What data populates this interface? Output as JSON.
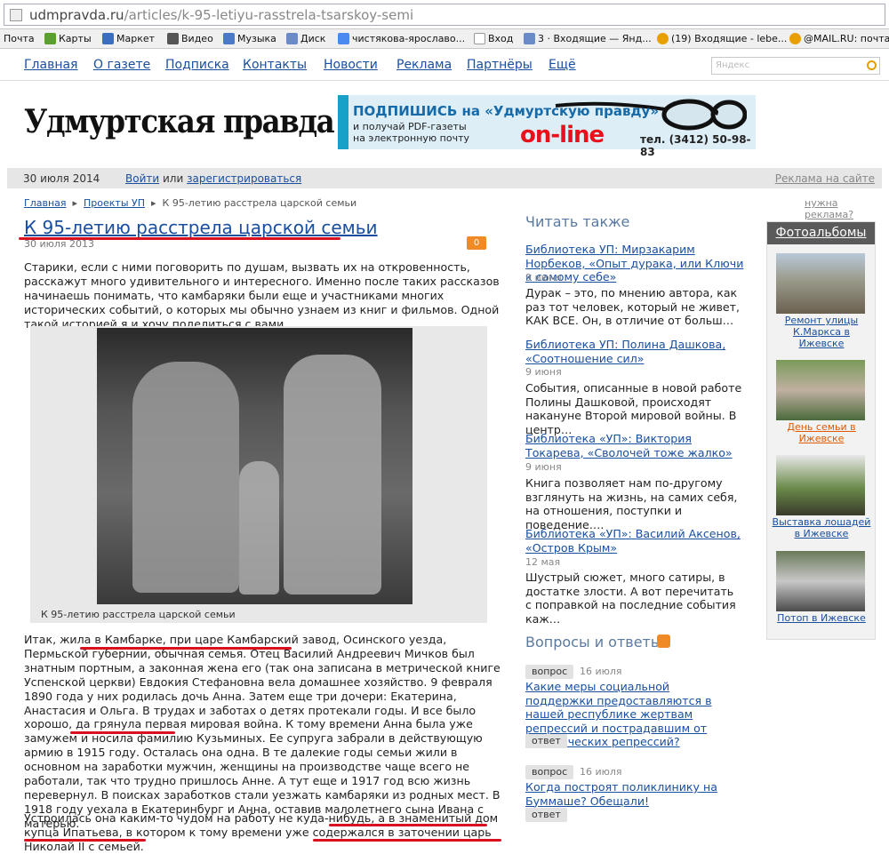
{
  "browser": {
    "url_domain": "udmpravda.ru",
    "url_path": "/articles/k-95-letiyu-rasstrela-tsarskoy-semi",
    "bookmarks": [
      "Почта",
      "Карты",
      "Маркет",
      "Видео",
      "Музыка",
      "Диск",
      "чистякова-ярославо...",
      "Вход",
      "3 · Входящие — Янд...",
      "(19) Входящие - lebe...",
      "@MAIL.RU: почта"
    ]
  },
  "nav": {
    "links": [
      "Главная",
      "О газете",
      "Подписка",
      "Контакты",
      "Новости",
      "Реклама",
      "Партнёры",
      "Ещё"
    ],
    "search_placeholder": "Яндекс"
  },
  "header": {
    "logo": "Удмуртская правда",
    "banner_line1": "ПОДПИШИСЬ на «Удмуртскую правду»",
    "banner_line2": "и получай PDF-газеты",
    "banner_line3": "на электронную почту",
    "banner_online": "on-line",
    "banner_phone": "тел. (3412) 50-98-83"
  },
  "strip": {
    "date": "30 июля 2014",
    "login": "Войти",
    "or": "или",
    "register": "зарегистрироваться",
    "ad": "Реклама на сайте"
  },
  "breadcrumb": [
    "Главная",
    "Проекты УП",
    "К 95-летию расстрела царской семьи"
  ],
  "need_ad": "нужна реклама?",
  "article": {
    "title": "К 95-летию расстрела царской семьи",
    "date": "30 июля 2013",
    "comments": "0",
    "intro": "Старики, если с ними поговорить по душам, вызвать их на откровенность, расскажут много удивительного и интересного. Именно после таких рассказов начинаешь понимать, что камбаряки были еще и участниками многих исторических событий, о которых мы обычно узнаем из книг и фильмов. Одной такой историей я и хочу поделиться с вами.",
    "photo_caption": "К 95-летию расстрела царской семьи",
    "body1": "Итак, жила в Камбарке, при царе Камбарский завод, Осинского уезда, Пермьской губернии, обычная семья. Отец Василий Андреевич Мичков был знатным портным, а законная жена его (так она записана в метрической книге Успенской церкви) Евдокия Стефановна вела домашнее хозяйство. 9 февраля 1890 года у них родилась дочь Анна. Затем еще три дочери: Екатерина, Анастасия и Ольга. В трудах и заботах о детях протекали годы. И все было хорошо, да грянула первая мировая война. К тому времени Анна была уже замужем и носила фамилию Кузьминых. Ее супруга забрали в действующую армию в 1915 году. Осталась она одна. В те далекие годы семьи жили в основном на заработки мужчин, женщины на производстве чаще всего не работали, так что трудно пришлось Анне. А тут еще и 1917 год всю жизнь перевернул. В поисках заработков стали уезжать камбаряки из родных мест. В 1918 году уехала в Екатеринбург и Анна, оставив малолетнего сына Ивана с матерью.",
    "body2": "Устроилась она каким-то чудом на работу не куда-нибудь, а в знаменитый дом купца Ипатьева, в котором к тому времени уже содержался в заточении царь Николай II с семьей."
  },
  "read_also": {
    "heading": "Читать также",
    "items": [
      {
        "title": "Библиотека УП: Мирзакарим Норбеков, «Опыт дурака, или Ключи к самому себе»",
        "date": "9 июня",
        "text": "Дурак – это, по мнению автора, как раз тот человек, который не живет, КАК ВСЕ. Он, в отличие от больш…"
      },
      {
        "title": "Библиотека УП: Полина Дашкова, «Соотношение сил»",
        "date": "9 июня",
        "text": "События, описанные в новой работе Полины Дашковой, происходят накануне Второй мировой войны. В центр…"
      },
      {
        "title": "Библиотека «УП»: Виктория Токарева, «Сволочей тоже жалко»",
        "date": "9 июня",
        "text": "Книга позволяет нам по-другому взглянуть на жизнь, на самих себя, на отношения, поступки и поведение…."
      },
      {
        "title": "Библиотека «УП»: Василий Аксенов, «Остров Крым»",
        "date": "12 мая",
        "text": "Шустрый сюжет, много сатиры, в достатке злости. А вот перечитать с поправкой на последние события каж…"
      }
    ]
  },
  "qa": {
    "heading": "Вопросы и ответы",
    "question_label": "вопрос",
    "answer_label": "ответ",
    "items": [
      {
        "date": "16 июля",
        "text": "Какие меры социальной поддержки предоставляются в нашей республике жертвам репрессий и пострадавшим от политических репрессий?"
      },
      {
        "date": "16 июля",
        "text": "Когда построят поликлинику на Буммаше? Обещали!"
      }
    ]
  },
  "albums": {
    "heading": "Фотоальбомы",
    "items": [
      "Ремонт улицы К.Маркса в Ижевске",
      "День семьи в Ижевске",
      "Выставка лошадей в Ижевске",
      "Потоп в Ижевске"
    ]
  }
}
